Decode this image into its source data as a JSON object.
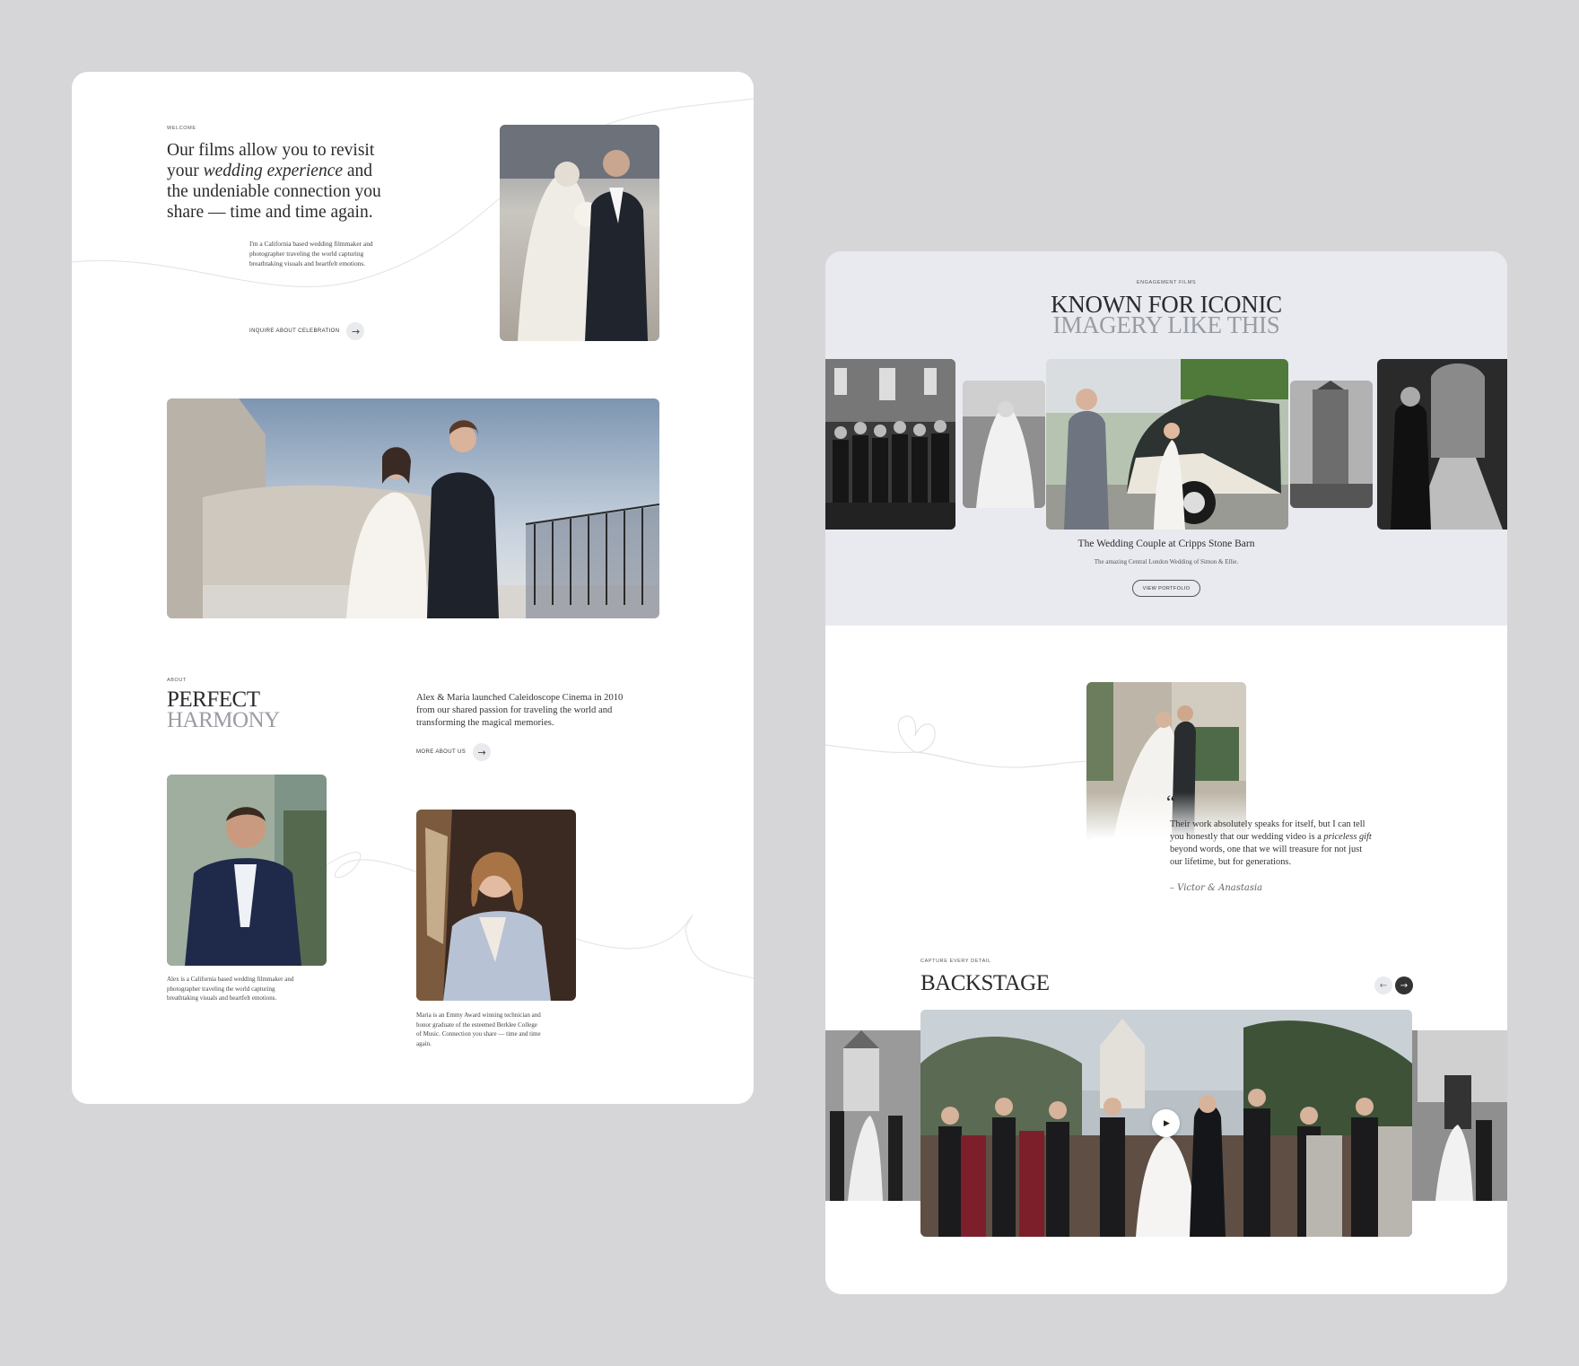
{
  "left_page": {
    "welcome_eyebrow": "WELCOME",
    "headline_1": "Our films allow you to revisit",
    "headline_2_pre": "your ",
    "headline_2_italic": "wedding experience",
    "headline_2_post": " and",
    "headline_3": "the undeniable connection you",
    "headline_4": "share — time and time again.",
    "intro_lines": [
      "I'm a California based wedding filmmaker and",
      "photographer traveling the world capturing",
      "breathtaking visuals and heartfelt emotions."
    ],
    "inquire_label": "INQUIRE ABOUT CELEBRATION",
    "about_eyebrow": "ABOUT",
    "about_title_1": "PERFECT",
    "about_title_2": "HARMONY",
    "about_text_lines": [
      "Alex & Maria launched Caleidoscope Cinema in 2010",
      "from our shared passion for traveling the world and",
      "transforming the magical memories."
    ],
    "more_about_label": "MORE ABOUT US",
    "alex_bio_lines": [
      "Alex is a California based wedding filmmaker and",
      "photographer traveling the world capturing",
      "breathtaking visuals and heartfelt emotions."
    ],
    "maria_bio_lines": [
      "Maria is an Emmy Award winning technician and",
      "honor graduate of the esteemed Berklee College",
      "of Music. Connection you share — time and time",
      "again."
    ]
  },
  "right_page": {
    "engagement_eyebrow": "ENGAGEMENT FILMS",
    "known_title_1": "KNOWN FOR ICONIC",
    "known_title_2": "IMAGERY LIKE THIS",
    "feature_title": "The Wedding Couple at Cripps Stone Barn",
    "feature_subtitle": "The amazing Central London Wedding of Simon & Ellie.",
    "view_portfolio_label": "VIEW PORTFOLIO",
    "quote_mark": "“",
    "quote_line_1": "Their work absolutely speaks for itself, but I can tell",
    "quote_line_2_pre": "you honestly that our wedding video is a ",
    "quote_line_2_italic": "priceless gift",
    "quote_line_3": "beyond words, one that we will treasure for not just",
    "quote_line_4": "our lifetime, but for generations.",
    "signature": "– Victor & Anastasia",
    "backstage_eyebrow": "CAPTURE EVERY DETAIL",
    "backstage_title": "BACKSTAGE",
    "prev_icon": "←",
    "next_icon": "→",
    "play_icon": "▶"
  },
  "icons": {
    "arrow_right": "→"
  },
  "colors": {
    "background": "#d6d6d8",
    "card": "#ffffff",
    "band": "#e8eaf0",
    "text": "#2b2b2e",
    "muted_title": "#9a9ca4"
  }
}
